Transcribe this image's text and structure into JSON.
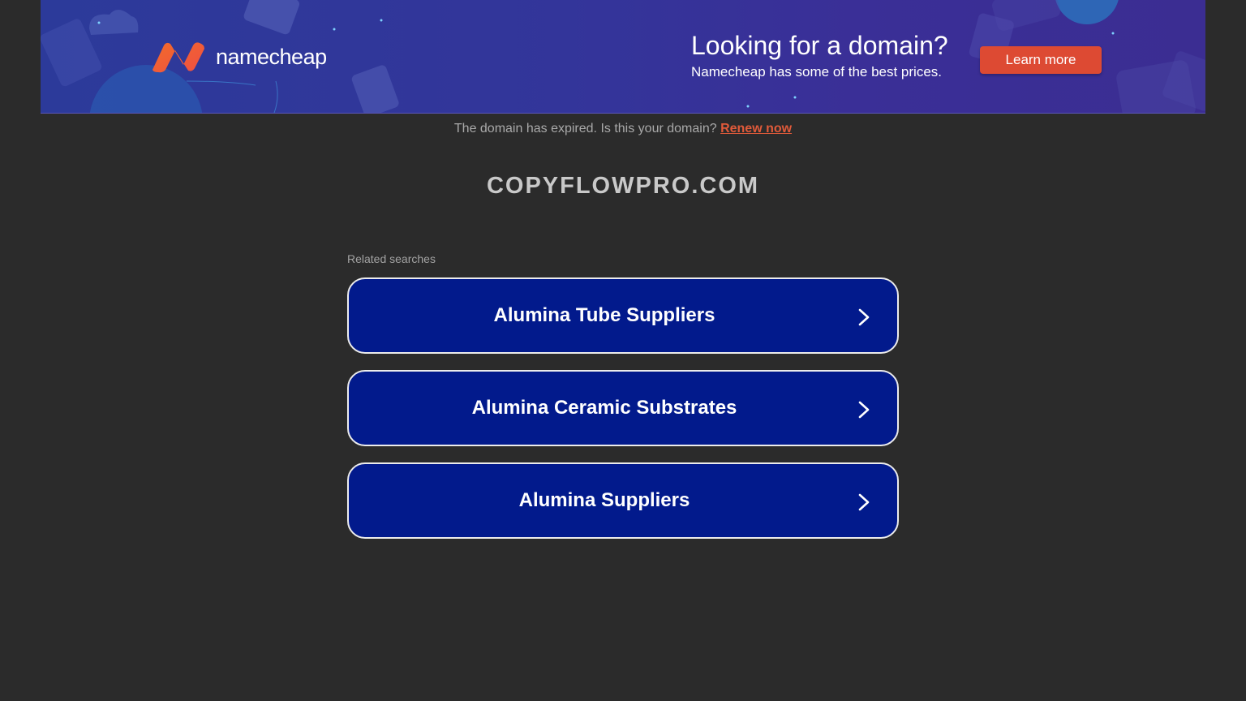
{
  "banner": {
    "logo_text": "namecheap",
    "headline": "Looking for a domain?",
    "subline": "Namecheap has some of the best prices.",
    "button_label": "Learn more",
    "colors": {
      "background_start": "#2c3a9a",
      "background_end": "#3b2d92",
      "button": "#dd4a33",
      "logo_gradient_start": "#f26b2a",
      "logo_gradient_end": "#ef4f43"
    }
  },
  "notice": {
    "text": "The domain has expired. Is this your domain?",
    "link_label": "Renew now"
  },
  "domain_name": "COPYFLOWPRO.COM",
  "related": {
    "label": "Related searches",
    "items": [
      {
        "label": "Alumina Tube Suppliers"
      },
      {
        "label": "Alumina Ceramic Substrates"
      },
      {
        "label": "Alumina Suppliers"
      }
    ]
  },
  "icons": {
    "logo": "namecheap-logo-icon",
    "arrow": "chevron-right-icon"
  }
}
